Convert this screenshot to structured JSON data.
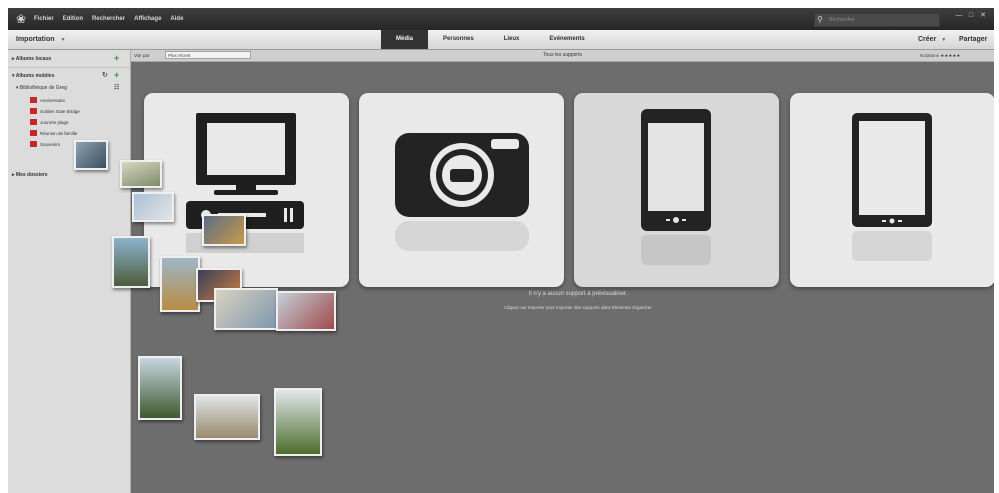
{
  "menubar": {
    "items": [
      "Fichier",
      "Edition",
      "Rechercher",
      "Affichage",
      "Aide"
    ],
    "search_placeholder": "Rechercher"
  },
  "toolbar": {
    "import_label": "Importation",
    "tabs": [
      "Média",
      "Personnes",
      "Lieux",
      "Evénements"
    ],
    "active_tab": "Média",
    "create_label": "Créer",
    "share_label": "Partager"
  },
  "sidebar": {
    "local_albums": "Albums locaux",
    "mobile_albums": "Albums mobiles",
    "library": "Bibliothèque de Greg",
    "albums": [
      "Anniversaire",
      "Golden Gate Bridge",
      "Journée plage",
      "Réunion de famille",
      "Souvenirs"
    ],
    "folders": "Mes dossiers"
  },
  "viewbar": {
    "view_label": "Voir par",
    "view_value": "Plus récent",
    "title": "Tous les supports",
    "sort_label": "Notations"
  },
  "main": {
    "empty_message": "Il n'y a aucun support à prévisualiser.",
    "hint": "Cliquez sur Importer pour importer des supports dans Elements Organizer"
  },
  "devices": [
    "computer-icon",
    "camera-icon",
    "smartphone-icon",
    "tablet-icon"
  ]
}
